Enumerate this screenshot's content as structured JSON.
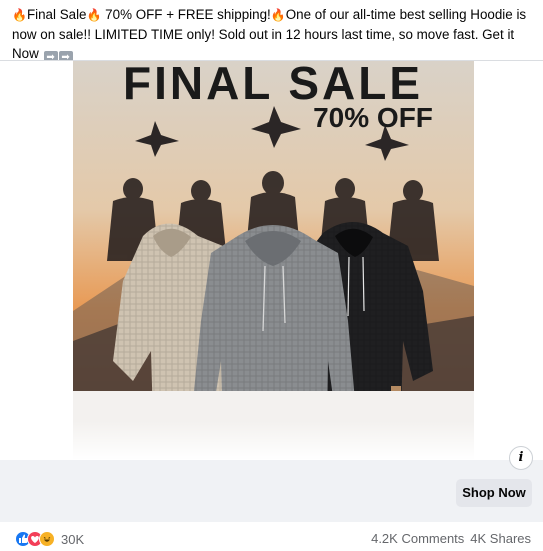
{
  "post": {
    "text_line1_part1": "Final Sale",
    "text_line1_part2": " 70% OFF + FREE shipping!",
    "text_line1_part3": "One of our all-time best selling Hoodie is now on",
    "text_line2": "sale!! LIMITED TIME only! Sold out in 12 hours last time, so move fast. Get it Now",
    "arrow_glyph": "➡"
  },
  "ad": {
    "headline": "FINAL SALE",
    "discount": "70% OFF",
    "colors": {
      "sky_top": "#d9d2c8",
      "sky_bottom": "#e89a55",
      "hoodie_beige": "#cfc3b1",
      "hoodie_grey": "#8a8d90",
      "hoodie_black": "#1f1f21"
    }
  },
  "cta": {
    "info_label": "i",
    "button_label": "Shop Now"
  },
  "footer": {
    "reaction_count": "30K",
    "comments": "4.2K Comments",
    "shares": "4K Shares",
    "reaction_icons": [
      "like-icon",
      "love-icon",
      "haha-icon"
    ],
    "reaction_colors": [
      "#1877f2",
      "#f33e58",
      "#f7b125"
    ]
  }
}
